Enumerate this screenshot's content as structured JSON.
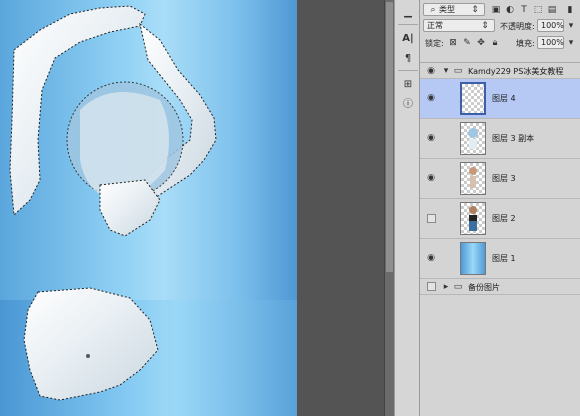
{
  "layers_panel": {
    "filter_kind": "类型",
    "blend_mode": "正常",
    "opacity_label": "不透明度:",
    "opacity_value": "100%",
    "lock_label": "锁定:",
    "fill_label": "填充:",
    "fill_value": "100%",
    "group_name": "Kamdy229 PS冰美女教程",
    "layers": [
      {
        "name": "图层 4",
        "visible": true,
        "selected": true
      },
      {
        "name": "图层 3 副本",
        "visible": true,
        "selected": false
      },
      {
        "name": "图层 3",
        "visible": true,
        "selected": false
      },
      {
        "name": "图层 2",
        "visible": false,
        "selected": false
      },
      {
        "name": "图层 1",
        "visible": true,
        "selected": false
      }
    ],
    "backup_group_name": "备份图片"
  },
  "colors": {
    "selected_layer": "#b6c9f5",
    "canvas_gradient_mid": "#a9ddf8"
  }
}
